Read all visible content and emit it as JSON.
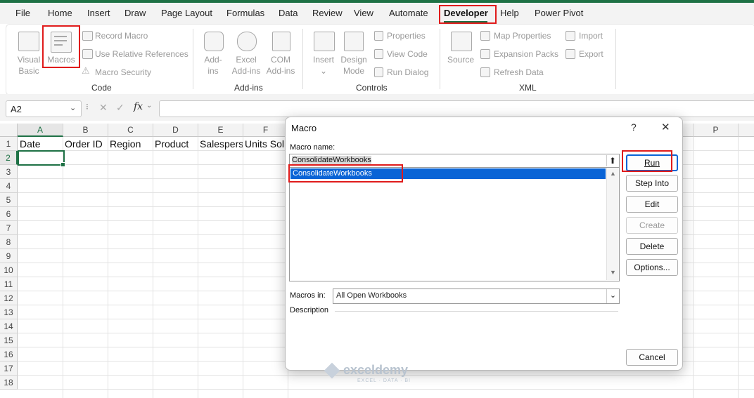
{
  "menu": [
    "File",
    "Home",
    "Insert",
    "Draw",
    "Page Layout",
    "Formulas",
    "Data",
    "Review",
    "View",
    "Automate",
    "Developer",
    "Help",
    "Power Pivot"
  ],
  "ribbon": {
    "code": {
      "visual_basic": [
        "Visual",
        "Basic"
      ],
      "macros": "Macros",
      "record_macro": "Record Macro",
      "relative_refs": "Use Relative References",
      "macro_security": "Macro Security",
      "group": "Code"
    },
    "addins": {
      "addins": [
        "Add-",
        "ins"
      ],
      "excel_addins": [
        "Excel",
        "Add-ins"
      ],
      "com_addins": [
        "COM",
        "Add-ins"
      ],
      "group": "Add-ins"
    },
    "controls": {
      "insert": "Insert",
      "design_mode": [
        "Design",
        "Mode"
      ],
      "properties": "Properties",
      "view_code": "View Code",
      "run_dialog": "Run Dialog",
      "group": "Controls"
    },
    "xml": {
      "source": "Source",
      "map_properties": "Map Properties",
      "expansion_packs": "Expansion Packs",
      "refresh_data": "Refresh Data",
      "import": "Import",
      "export": "Export",
      "group": "XML"
    }
  },
  "formula_bar": {
    "name_box": "A2",
    "fx": "fx",
    "value": ""
  },
  "grid": {
    "columns": [
      "A",
      "B",
      "C",
      "D",
      "E",
      "F",
      "P"
    ],
    "rows": [
      "1",
      "2",
      "3",
      "4",
      "5",
      "6",
      "7",
      "8",
      "9",
      "10",
      "11",
      "12",
      "13",
      "14",
      "15",
      "16",
      "17",
      "18"
    ],
    "headers": [
      "Date",
      "Order ID",
      "Region",
      "Product",
      "Salespers",
      "Units Sol"
    ],
    "selected_cell": "A2"
  },
  "dialog": {
    "title": "Macro",
    "help": "?",
    "close": "✕",
    "macro_name_label": "Macro name:",
    "macro_name_value": "ConsolidateWorkbooks",
    "macros": [
      "ConsolidateWorkbooks"
    ],
    "buttons": {
      "run": "Run",
      "step_into": "Step Into",
      "edit": "Edit",
      "create": "Create",
      "delete": "Delete",
      "options": "Options...",
      "cancel": "Cancel"
    },
    "macros_in_label": "Macros in:",
    "macros_in_value": "All Open Workbooks",
    "description_label": "Description"
  },
  "watermark": {
    "name": "exceldemy",
    "tagline": "EXCEL · DATA · BI"
  },
  "colors": {
    "excel_green": "#1e7145",
    "highlight_red": "#e01b1b",
    "selection_blue": "#0a64d6"
  }
}
